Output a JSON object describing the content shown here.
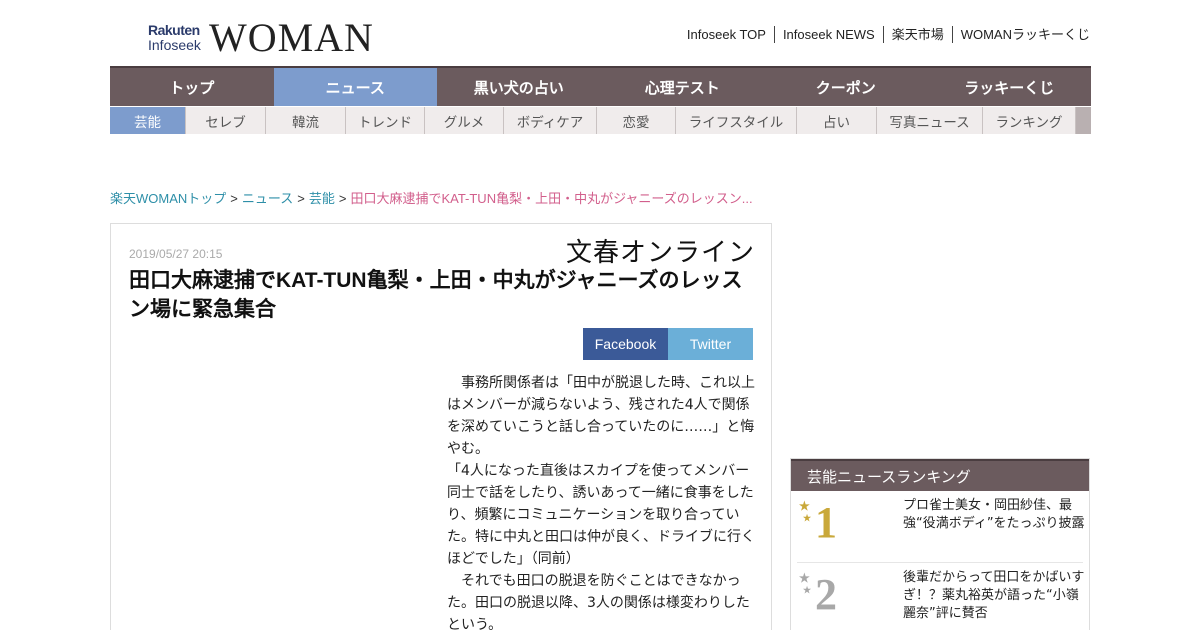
{
  "header": {
    "logo_rakuten": "Rakuten",
    "logo_infoseek": "Infoseek",
    "logo_woman": "WOMAN",
    "top_links": [
      "Infoseek TOP",
      "Infoseek NEWS",
      "楽天市場",
      "WOMANラッキーくじ"
    ]
  },
  "main_nav": [
    {
      "label": "トップ"
    },
    {
      "label": "ニュース",
      "active": true
    },
    {
      "label": "黒い犬の占い"
    },
    {
      "label": "心理テスト"
    },
    {
      "label": "クーポン"
    },
    {
      "label": "ラッキーくじ"
    }
  ],
  "sub_nav": [
    {
      "label": "芸能",
      "active": true
    },
    {
      "label": "セレブ"
    },
    {
      "label": "韓流"
    },
    {
      "label": "トレンド"
    },
    {
      "label": "グルメ"
    },
    {
      "label": "ボディケア"
    },
    {
      "label": "恋愛"
    },
    {
      "label": "ライフスタイル"
    },
    {
      "label": "占い"
    },
    {
      "label": "写真ニュース"
    },
    {
      "label": "ランキング"
    }
  ],
  "breadcrumb": {
    "items": [
      "楽天WOMANトップ",
      "ニュース",
      "芸能"
    ],
    "separator": ">",
    "current": "田口大麻逮捕でKAT-TUN亀梨・上田・中丸がジャニーズのレッスン..."
  },
  "article": {
    "date": "2019/05/27 20:15",
    "source": "文春オンライン",
    "title": "田口大麻逮捕でKAT-TUN亀梨・上田・中丸がジャニーズのレッスン場に緊急集合",
    "share": {
      "facebook": "Facebook",
      "twitter": "Twitter"
    },
    "paragraphs": [
      "　事務所関係者は「田中が脱退した時、これ以上はメンバーが減らないよう、残された4人で関係を深めていこうと話し合っていたのに……」と悔やむ。",
      "「4人になった直後はスカイプを使ってメンバー同士で話をしたり、誘いあって一緒に食事をしたり、頻繁にコミュニケーションを取り合っていた。特に中丸と田口は仲が良く、ドライブに行くほどでした」（同前）",
      "　それでも田口の脱退を防ぐことはできなかった。田口の脱退以降、3人の関係は様変わりしたという。"
    ]
  },
  "ranking": {
    "title": "芸能ニュースランキング",
    "items": [
      {
        "rank": "1",
        "title": "プロ雀士美女・岡田紗佳、最強“役満ボディ”をたっぷり披露"
      },
      {
        "rank": "2",
        "title": "後輩だからって田口をかばいすぎ！？薬丸裕英が語った“小嶺麗奈”評に賛否"
      }
    ]
  },
  "colors": {
    "nav_bg": "#6b5b5e",
    "nav_active": "#7d9ccd",
    "link": "#2e8fa8",
    "current": "#d25f8c",
    "facebook": "#3b5a98",
    "twitter": "#6bafd8"
  }
}
